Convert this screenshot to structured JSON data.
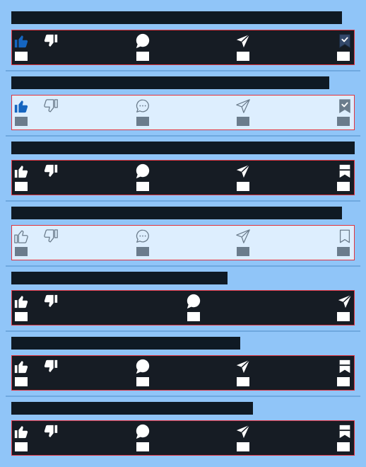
{
  "colors": {
    "background": "#90c5f8",
    "toolbar_dark": "#161c24",
    "toolbar_light": "#ddeefe",
    "toolbar_border": "#e0343f",
    "active_blue": "#1565c0",
    "white": "#ffffff",
    "muted_gray": "#6b7c8c"
  },
  "posts": [
    {
      "theme": "dark",
      "actions": [
        {
          "icon": "thumb-up-icon",
          "state": "active"
        },
        {
          "icon": "thumb-down-icon",
          "state": "normal"
        },
        {
          "icon": "comment-icon",
          "state": "normal"
        },
        {
          "icon": "share-icon",
          "state": "normal"
        },
        {
          "icon": "bookmark-check-icon",
          "state": "active"
        }
      ]
    },
    {
      "theme": "light",
      "actions": [
        {
          "icon": "thumb-up-icon",
          "state": "active"
        },
        {
          "icon": "thumb-down-icon",
          "state": "normal"
        },
        {
          "icon": "comment-icon",
          "state": "normal"
        },
        {
          "icon": "share-icon",
          "state": "normal"
        },
        {
          "icon": "bookmark-check-icon",
          "state": "normal"
        }
      ]
    },
    {
      "theme": "dark",
      "actions": [
        {
          "icon": "thumb-up-icon",
          "state": "normal"
        },
        {
          "icon": "thumb-down-icon",
          "state": "normal"
        },
        {
          "icon": "comment-icon",
          "state": "normal"
        },
        {
          "icon": "share-icon",
          "state": "normal"
        },
        {
          "icon": "bookmark-icon",
          "state": "normal"
        }
      ]
    },
    {
      "theme": "light",
      "actions": [
        {
          "icon": "thumb-up-icon",
          "state": "normal"
        },
        {
          "icon": "thumb-down-icon",
          "state": "normal"
        },
        {
          "icon": "comment-icon",
          "state": "normal"
        },
        {
          "icon": "share-icon",
          "state": "normal"
        },
        {
          "icon": "bookmark-icon",
          "state": "normal"
        }
      ]
    },
    {
      "theme": "dark",
      "actions": [
        {
          "icon": "thumb-up-icon",
          "state": "normal"
        },
        {
          "icon": "thumb-down-icon",
          "state": "normal"
        },
        {
          "icon": "comment-icon",
          "state": "normal"
        },
        {
          "icon": "share-icon",
          "state": "normal"
        }
      ]
    },
    {
      "theme": "dark",
      "actions": [
        {
          "icon": "thumb-up-icon",
          "state": "normal"
        },
        {
          "icon": "thumb-down-icon",
          "state": "normal"
        },
        {
          "icon": "comment-icon",
          "state": "normal"
        },
        {
          "icon": "share-icon",
          "state": "normal"
        },
        {
          "icon": "bookmark-icon",
          "state": "normal"
        }
      ]
    },
    {
      "theme": "dark",
      "actions": [
        {
          "icon": "thumb-up-icon",
          "state": "normal"
        },
        {
          "icon": "thumb-down-icon",
          "state": "normal"
        },
        {
          "icon": "comment-icon",
          "state": "normal"
        },
        {
          "icon": "share-icon",
          "state": "normal"
        },
        {
          "icon": "bookmark-icon",
          "state": "normal"
        }
      ]
    }
  ]
}
